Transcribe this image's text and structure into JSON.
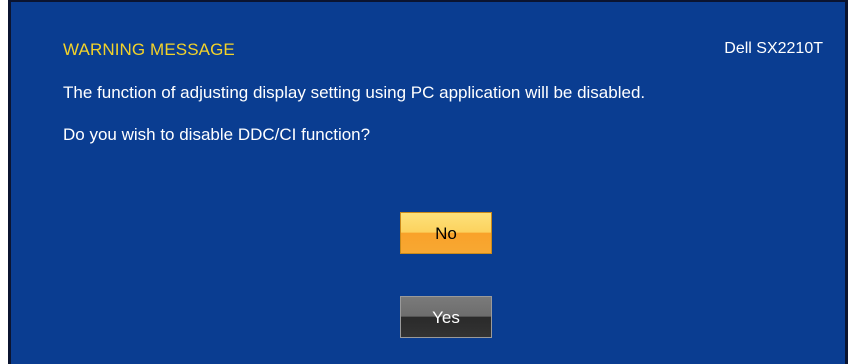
{
  "dialog": {
    "title": "WARNING MESSAGE",
    "model": "Dell SX2210T",
    "message_line1": "The function of adjusting display setting using PC application will be disabled.",
    "message_line2": "Do you wish to disable DDC/CI function?",
    "no_label": "No",
    "yes_label": "Yes"
  },
  "colors": {
    "background": "#0a3d91",
    "title": "#f2d22a",
    "text": "#ffffff",
    "no_button": "#f9a22a",
    "yes_button": "#333333"
  }
}
